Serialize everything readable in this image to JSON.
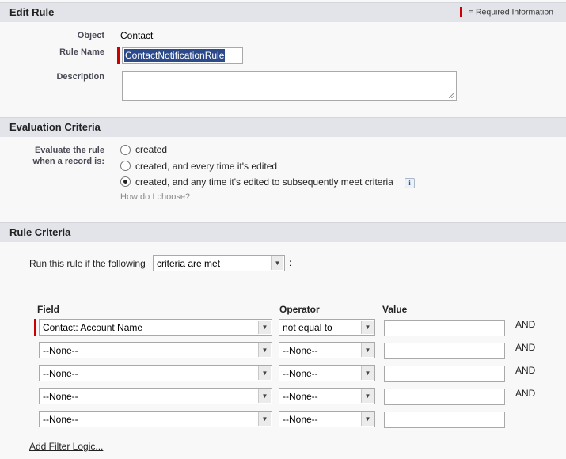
{
  "edit_rule": {
    "title": "Edit Rule",
    "required_legend": "= Required Information",
    "object_label": "Object",
    "object_value": "Contact",
    "rule_name_label": "Rule Name",
    "rule_name_value": "ContactNotificationRule",
    "description_label": "Description",
    "description_value": ""
  },
  "evaluation": {
    "title": "Evaluation Criteria",
    "label_line1": "Evaluate the rule",
    "label_line2": "when a record is:",
    "options": [
      {
        "label": "created",
        "selected": false
      },
      {
        "label": "created, and every time it's edited",
        "selected": false
      },
      {
        "label": "created, and any time it's edited to subsequently meet criteria",
        "selected": true
      }
    ],
    "info_icon": "info-icon",
    "help_link": "How do I choose?"
  },
  "rule_criteria": {
    "title": "Rule Criteria",
    "run_label": "Run this rule if the following",
    "run_select": "criteria are met",
    "run_suffix": ":",
    "headers": {
      "field": "Field",
      "operator": "Operator",
      "value": "Value"
    },
    "rows": [
      {
        "field": "Contact: Account Name",
        "operator": "not equal to",
        "value": "",
        "conj": "AND",
        "required": true
      },
      {
        "field": "--None--",
        "operator": "--None--",
        "value": "",
        "conj": "AND",
        "required": false
      },
      {
        "field": "--None--",
        "operator": "--None--",
        "value": "",
        "conj": "AND",
        "required": false
      },
      {
        "field": "--None--",
        "operator": "--None--",
        "value": "",
        "conj": "AND",
        "required": false
      },
      {
        "field": "--None--",
        "operator": "--None--",
        "value": "",
        "conj": "",
        "required": false
      }
    ],
    "add_filter_logic": "Add Filter Logic..."
  },
  "colors": {
    "required": "#cc0000",
    "header_bg": "#e2e4ea",
    "selection": "#2c4a8a"
  }
}
